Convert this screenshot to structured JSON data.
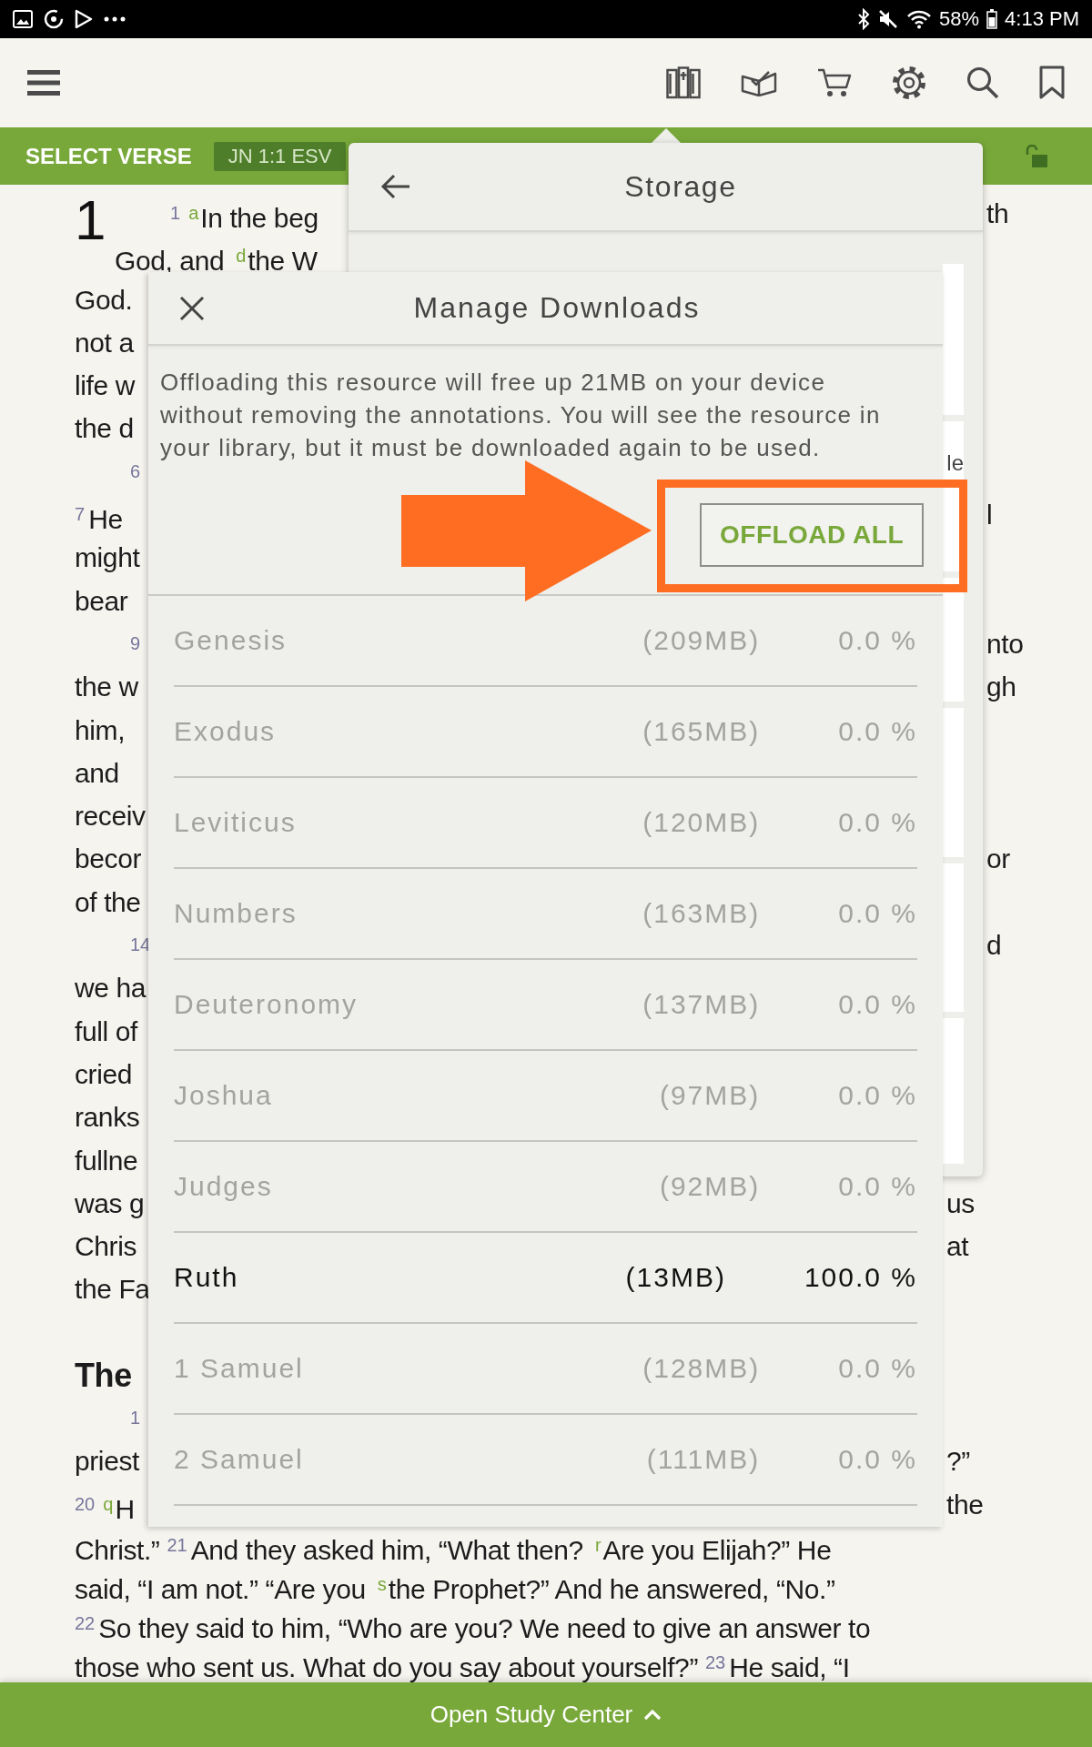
{
  "status_bar": {
    "battery": "58%",
    "time": "4:13 PM"
  },
  "verse_bar": {
    "label": "SELECT VERSE",
    "reference": "JN 1:1 ESV"
  },
  "bible_text": {
    "chapter_number": "1",
    "lines": [
      {
        "kind": "paragraph_start",
        "parts": [
          {
            "kind": "verse",
            "text": "1"
          },
          {
            "kind": "note",
            "text": "a"
          },
          {
            "kind": "text",
            "text": "In the beg"
          }
        ],
        "right": "th"
      },
      {
        "kind": "line",
        "parts": [
          {
            "kind": "text",
            "text": "God, and"
          },
          {
            "kind": "note",
            "text": "d"
          },
          {
            "kind": "text",
            "text": "the W"
          }
        ]
      },
      {
        "kind": "line",
        "parts": [
          {
            "kind": "text",
            "text": "God."
          }
        ]
      },
      {
        "kind": "line",
        "parts": [
          {
            "kind": "text",
            "text": "not a"
          }
        ]
      },
      {
        "kind": "line",
        "parts": [
          {
            "kind": "text",
            "text": "life w"
          }
        ]
      },
      {
        "kind": "line",
        "parts": [
          {
            "kind": "text",
            "text": "the d"
          }
        ]
      },
      {
        "kind": "paragraph_start",
        "parts": [
          {
            "kind": "verse",
            "text": "6"
          }
        ]
      },
      {
        "kind": "line",
        "parts": [
          {
            "kind": "verse",
            "text": "7"
          },
          {
            "kind": "text",
            "text": "He"
          }
        ],
        "right": "l"
      },
      {
        "kind": "line",
        "parts": [
          {
            "kind": "text",
            "text": "might"
          }
        ]
      },
      {
        "kind": "line",
        "parts": [
          {
            "kind": "text",
            "text": "bear"
          }
        ]
      },
      {
        "kind": "paragraph_start",
        "parts": [
          {
            "kind": "verse",
            "text": "9"
          }
        ],
        "right": "nto"
      },
      {
        "kind": "line",
        "parts": [
          {
            "kind": "text",
            "text": "the w"
          }
        ],
        "right": "gh"
      },
      {
        "kind": "line",
        "parts": [
          {
            "kind": "text",
            "text": "him,"
          }
        ]
      },
      {
        "kind": "line",
        "parts": [
          {
            "kind": "text",
            "text": "and"
          }
        ]
      },
      {
        "kind": "line",
        "parts": [
          {
            "kind": "text",
            "text": "receiv"
          }
        ]
      },
      {
        "kind": "line",
        "parts": [
          {
            "kind": "text",
            "text": "becor"
          }
        ],
        "right": "or"
      },
      {
        "kind": "line",
        "parts": [
          {
            "kind": "text",
            "text": "of the"
          }
        ]
      },
      {
        "kind": "paragraph_start",
        "parts": [
          {
            "kind": "verse",
            "text": "14"
          }
        ],
        "right": "d"
      },
      {
        "kind": "line",
        "parts": [
          {
            "kind": "text",
            "text": "we ha"
          }
        ]
      },
      {
        "kind": "line",
        "parts": [
          {
            "kind": "text",
            "text": "full of"
          }
        ]
      },
      {
        "kind": "line",
        "parts": [
          {
            "kind": "text",
            "text": "cried"
          }
        ]
      },
      {
        "kind": "line",
        "parts": [
          {
            "kind": "text",
            "text": "ranks"
          }
        ]
      },
      {
        "kind": "line",
        "parts": [
          {
            "kind": "text",
            "text": "fullne"
          }
        ]
      },
      {
        "kind": "line",
        "parts": [
          {
            "kind": "text",
            "text": "was g"
          }
        ],
        "right": "us"
      },
      {
        "kind": "line",
        "parts": [
          {
            "kind": "text",
            "text": "Chris"
          }
        ],
        "right": "at"
      },
      {
        "kind": "line",
        "parts": [
          {
            "kind": "text",
            "text": "the Fa"
          }
        ]
      },
      {
        "kind": "heading",
        "parts": [
          {
            "kind": "text",
            "text": "The"
          }
        ]
      },
      {
        "kind": "paragraph_start",
        "parts": [
          {
            "kind": "verse",
            "text": "1"
          }
        ]
      },
      {
        "kind": "line",
        "parts": [
          {
            "kind": "text",
            "text": "priest"
          }
        ],
        "right": "?”"
      },
      {
        "kind": "line",
        "parts": [
          {
            "kind": "verse",
            "text": "20"
          },
          {
            "kind": "note",
            "text": "q"
          },
          {
            "kind": "text",
            "text": "H"
          }
        ],
        "right": "the"
      },
      {
        "kind": "line",
        "parts": [
          {
            "kind": "text",
            "text": "Christ.”"
          },
          {
            "kind": "verse",
            "text": "21"
          },
          {
            "kind": "text",
            "text": "And they asked him, “What then?"
          },
          {
            "kind": "note",
            "text": "r"
          },
          {
            "kind": "text",
            "text": "Are you Elijah?” He"
          }
        ]
      },
      {
        "kind": "line",
        "parts": [
          {
            "kind": "text",
            "text": "said, “I am not.” “Are you"
          },
          {
            "kind": "note",
            "text": "s"
          },
          {
            "kind": "text",
            "text": "the Prophet?” And he answered, “No.”"
          }
        ]
      },
      {
        "kind": "line",
        "parts": [
          {
            "kind": "verse",
            "text": "22"
          },
          {
            "kind": "text",
            "text": "So they said to him, “Who are you? We need to give an answer to"
          }
        ]
      },
      {
        "kind": "line",
        "parts": [
          {
            "kind": "text",
            "text": "those who sent us. What do you say about yourself?”"
          },
          {
            "kind": "verse",
            "text": "23"
          },
          {
            "kind": "text",
            "text": "He said, “I"
          }
        ]
      }
    ]
  },
  "storage_panel": {
    "title": "Storage",
    "card_text": "le"
  },
  "manage_downloads": {
    "title": "Manage Downloads",
    "description": "Offloading this resource will free up 21MB on your device without removing the annotations. You will see the resource in your library, but it must be downloaded again to be used.",
    "button": "OFFLOAD ALL",
    "books": [
      {
        "name": "Genesis",
        "size": "(209MB)",
        "percent": "0.0 %",
        "downloaded": false
      },
      {
        "name": "Exodus",
        "size": "(165MB)",
        "percent": "0.0 %",
        "downloaded": false
      },
      {
        "name": "Leviticus",
        "size": "(120MB)",
        "percent": "0.0 %",
        "downloaded": false
      },
      {
        "name": "Numbers",
        "size": "(163MB)",
        "percent": "0.0 %",
        "downloaded": false
      },
      {
        "name": "Deuteronomy",
        "size": "(137MB)",
        "percent": "0.0 %",
        "downloaded": false
      },
      {
        "name": "Joshua",
        "size": "(97MB)",
        "percent": "0.0 %",
        "downloaded": false
      },
      {
        "name": "Judges",
        "size": "(92MB)",
        "percent": "0.0 %",
        "downloaded": false
      },
      {
        "name": "Ruth",
        "size": "(13MB)",
        "percent": "100.0 %",
        "downloaded": true
      },
      {
        "name": "1 Samuel",
        "size": "(128MB)",
        "percent": "0.0 %",
        "downloaded": false
      },
      {
        "name": "2 Samuel",
        "size": "(111MB)",
        "percent": "0.0 %",
        "downloaded": false
      }
    ]
  },
  "bottom_bar": {
    "label": "Open Study Center"
  }
}
